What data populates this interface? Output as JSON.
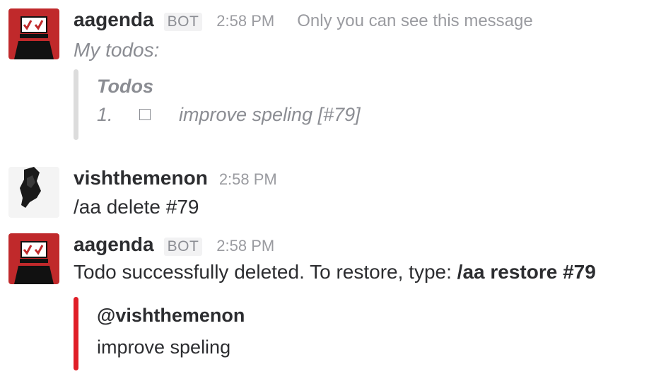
{
  "messages": [
    {
      "sender": "aagenda",
      "badge": "BOT",
      "time": "2:58 PM",
      "note": "Only you can see this message",
      "text": "My todos:",
      "attachment": {
        "title": "Todos",
        "items": [
          {
            "number": "1.",
            "text": "improve speling [#79]"
          }
        ]
      }
    },
    {
      "sender": "vishthemenon",
      "time": "2:58 PM",
      "text": "/aa delete #79"
    },
    {
      "sender": "aagenda",
      "badge": "BOT",
      "time": "2:58 PM",
      "text_prefix": "Todo successfully deleted. To restore, type: ",
      "text_command": "/aa restore #79",
      "attachment": {
        "title": "@vishthemenon",
        "body": "improve speling"
      }
    }
  ],
  "colors": {
    "grey_bar": "#dcdcdc",
    "red_bar": "#e01e27",
    "bot_avatar_bg": "#c0292b"
  }
}
